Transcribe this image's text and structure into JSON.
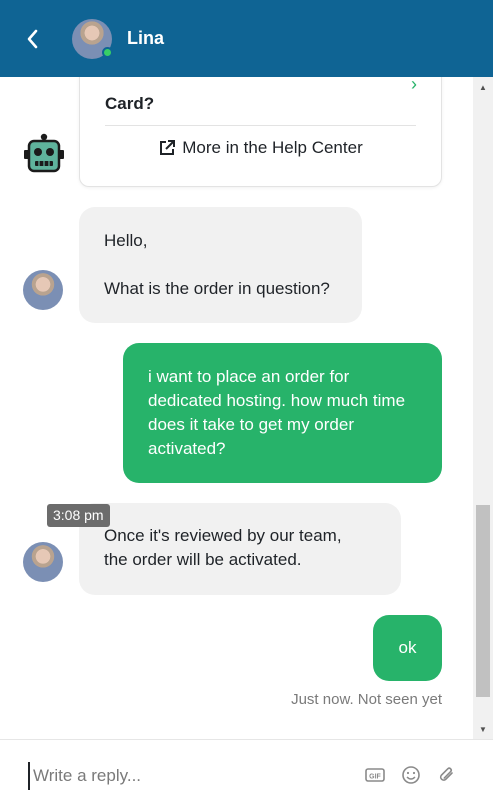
{
  "header": {
    "back_icon": "chevron-left-icon",
    "contact_name": "Lina",
    "status": "online",
    "bg_color": "#0f6494"
  },
  "help_card": {
    "title": "Card?",
    "link_label": "More in the Help Center",
    "link_icon": "external-link-icon"
  },
  "messages": [
    {
      "direction": "in",
      "sender": "Lina",
      "lines": [
        "Hello,",
        "",
        "What is the order in question?"
      ]
    },
    {
      "direction": "out",
      "lines": [
        "i want to place an order for",
        "dedicated hosting. how much time",
        "does it take to get my order",
        "activated?"
      ]
    },
    {
      "direction": "in",
      "sender": "Lina",
      "time": "3:08 pm",
      "lines": [
        "Once it's reviewed by our team,",
        "the order will be activated."
      ]
    },
    {
      "direction": "out",
      "lines": [
        "ok"
      ]
    }
  ],
  "seen_status": "Just now. Not seen yet",
  "composer": {
    "placeholder": "Write a reply...",
    "icons": [
      "gif-icon",
      "emoji-icon",
      "paperclip-icon"
    ]
  },
  "colors": {
    "outgoing_bubble": "#27b36a",
    "incoming_bubble": "#f1f1f1",
    "accent": "#0f6494"
  }
}
